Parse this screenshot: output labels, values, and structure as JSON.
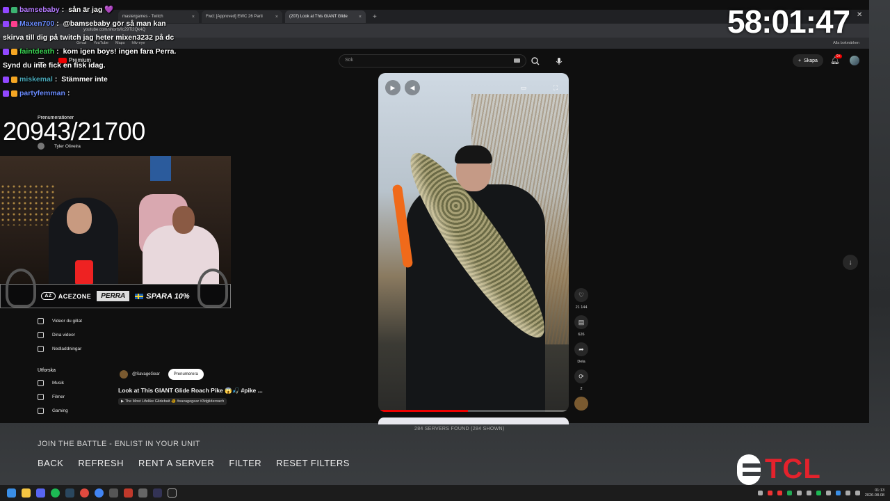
{
  "browser": {
    "tabs": [
      {
        "label": "mastergames - Twitch",
        "active": false
      },
      {
        "label": "Fwd: [Approved] EWC 26 Parti",
        "active": false
      },
      {
        "label": "(207) Look at This GIANT Glide",
        "active": true
      }
    ],
    "url": "youtube.com/shorts/Ic29Ti2Qk4Q",
    "bookmarks": [
      "Gmail",
      "YouTube",
      "Maps",
      "hltv eye"
    ],
    "bookmarks_right": "Alla bokmärken"
  },
  "youtube": {
    "logo_label": "Premium",
    "search_placeholder": "Sök",
    "create_label": "Skapa",
    "notif_count": "9+",
    "sidebar": {
      "subscriptions_heading": "Prenumerationer",
      "subscription_channel": "Tyler Oliveira",
      "you_items": [
        "Videor du gillat",
        "Dina videor",
        "Nedladdningar"
      ],
      "explore_heading": "Utforska",
      "explore_items": [
        "Musik",
        "Filmer",
        "Gaming"
      ]
    },
    "short": {
      "channel": "@SavageGear",
      "subscribe_label": "Prenumerera",
      "title": "Look at This GIANT Glide Roach Pike 😱🎣 #pike ...",
      "link_text": "▶ The Most Lifelike Glidebait 🐠 #savagegear #3dglideroach",
      "progress": 0.47,
      "likes": "21 144",
      "comments": "626",
      "share_label": "Dela",
      "remix_count": "2"
    }
  },
  "game": {
    "servers_found": "284 SERVERS FOUND (284 SHOWN)",
    "heading": "JOIN THE BATTLE - ENLIST IN YOUR UNIT",
    "menu": [
      "BACK",
      "REFRESH",
      "RENT A SERVER",
      "FILTER",
      "RESET FILTERS"
    ]
  },
  "stream": {
    "chat": [
      {
        "user": "bamsebaby",
        "text": "sån är jag 💜",
        "color": "#b57bff"
      },
      {
        "user": "Maxen700",
        "text": "@bamsebaby gör så man kan",
        "color": "#6a8cff"
      },
      {
        "user": "",
        "text": "skirva till dig på twitch jag heter mixen3232 på dc",
        "color": "#fff"
      },
      {
        "user": "faintdeath",
        "text": "kom igen boys! ingen fara Perra.",
        "color": "#3ad653"
      },
      {
        "user": "",
        "text": "Synd du inte fick en fisk idag.",
        "color": "#fff"
      },
      {
        "user": "miskemal",
        "text": "Stämmer inte",
        "color": "#4aa8b8"
      },
      {
        "user": "partyfemman",
        "text": "",
        "color": "#6a8cff"
      }
    ],
    "counter": "20943/21700",
    "timer": "58:01:47",
    "ad": {
      "brand": "ACEZONE",
      "brand_mark": "AZ",
      "code": "PERRA",
      "offer": "SPARA 10%"
    },
    "sponsor_logo": "TCL"
  },
  "taskbar": {
    "time": "01:13",
    "date": "2026-08-08"
  }
}
